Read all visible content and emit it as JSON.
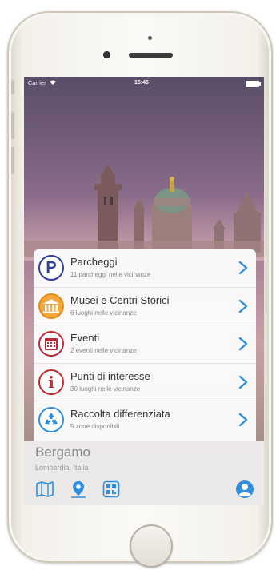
{
  "status_bar": {
    "carrier": "Carrier",
    "time": "15:45"
  },
  "list": {
    "items": [
      {
        "title": "Parcheggi",
        "subtitle": "11 parcheggi nelle vicinanze",
        "icon": "parking-icon",
        "icon_text": "P"
      },
      {
        "title": "Musei e Centri Storici",
        "subtitle": "6 luoghi nelle vicinanze",
        "icon": "museum-icon"
      },
      {
        "title": "Eventi",
        "subtitle": "2 eventi nelle vicinanze",
        "icon": "calendar-icon"
      },
      {
        "title": "Punti di interesse",
        "subtitle": "30 luoghi nelle vicinanze",
        "icon": "info-icon",
        "icon_text": "i"
      },
      {
        "title": "Raccolta differenziata",
        "subtitle": "5 zone disponibili",
        "icon": "recycle-icon"
      }
    ]
  },
  "location": {
    "city": "Bergamo",
    "region": "Lombardia, Italia"
  },
  "toolbar": {
    "icons": [
      "map-icon",
      "location-pin-icon",
      "qr-code-icon",
      "profile-icon"
    ]
  },
  "colors": {
    "accent_blue": "#2f8fdc",
    "parking_blue": "#2f3f98",
    "museum_orange": "#f4a63a",
    "events_red": "#b82c3b",
    "info_red": "#c22a34"
  }
}
